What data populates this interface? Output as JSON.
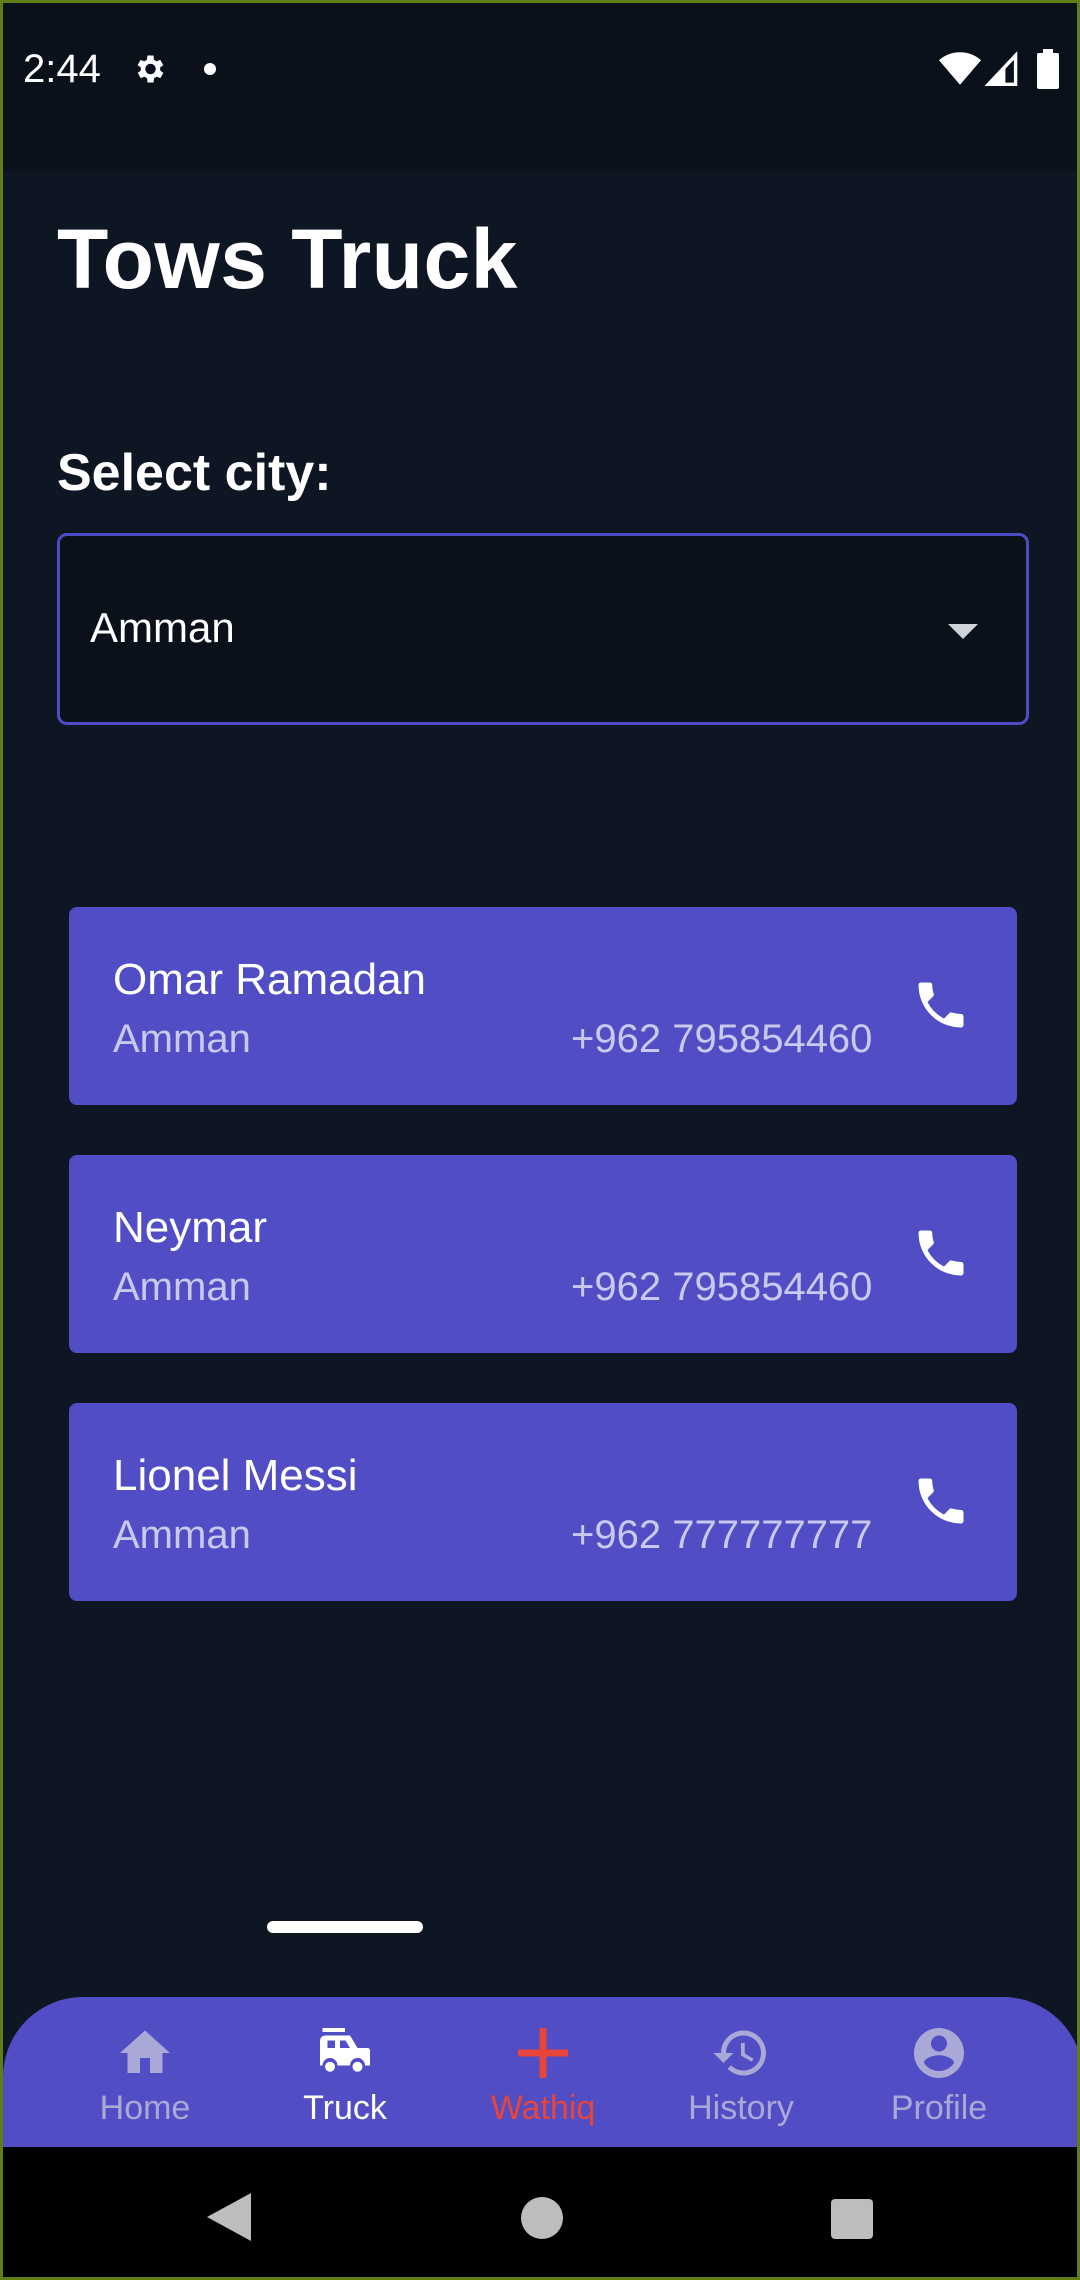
{
  "status_bar": {
    "time": "2:44",
    "icons": [
      "gear-icon",
      "dot",
      "wifi-icon",
      "signal-icon",
      "battery-icon"
    ]
  },
  "page": {
    "title": "Tows Truck",
    "select_label": "Select city:",
    "selected_city": "Amman"
  },
  "contacts": [
    {
      "name": "Omar Ramadan",
      "city": "Amman",
      "phone": "+962 795854460"
    },
    {
      "name": "Neymar",
      "city": "Amman",
      "phone": "+962 795854460"
    },
    {
      "name": "Lionel Messi",
      "city": "Amman",
      "phone": "+962 777777777"
    }
  ],
  "bottom_nav": {
    "items": [
      {
        "label": "Home",
        "icon": "home-icon"
      },
      {
        "label": "Truck",
        "icon": "fire-truck-icon",
        "active": true
      },
      {
        "label": "Wathiq",
        "icon": "plus-icon"
      },
      {
        "label": "History",
        "icon": "history-icon"
      },
      {
        "label": "Profile",
        "icon": "profile-icon"
      }
    ]
  },
  "colors": {
    "background": "#0f1623",
    "accent": "#514dc5",
    "danger": "#e8443a",
    "frame_border": "#5f7f16"
  }
}
